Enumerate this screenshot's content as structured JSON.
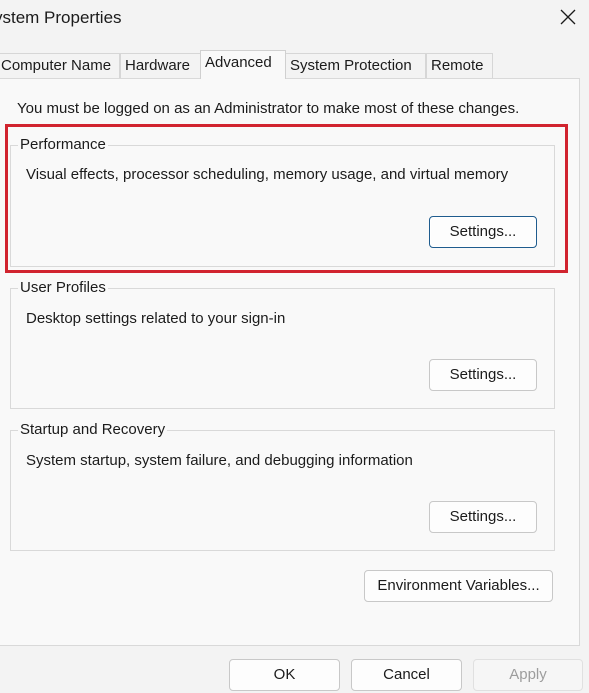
{
  "window": {
    "title": "ystem Properties"
  },
  "tabs": [
    {
      "label": "Computer Name",
      "active": false
    },
    {
      "label": "Hardware",
      "active": false
    },
    {
      "label": "Advanced",
      "active": true
    },
    {
      "label": "System Protection",
      "active": false
    },
    {
      "label": "Remote",
      "active": false
    }
  ],
  "admin_note": "You must be logged on as an Administrator to make most of these changes.",
  "performance": {
    "label": "Performance",
    "description": "Visual effects, processor scheduling, memory usage, and virtual memory",
    "settings_label": "Settings..."
  },
  "user_profiles": {
    "label": "User Profiles",
    "description": "Desktop settings related to your sign-in",
    "settings_label": "Settings..."
  },
  "startup_recovery": {
    "label": "Startup and Recovery",
    "description": "System startup, system failure, and debugging information",
    "settings_label": "Settings..."
  },
  "environment_variables_label": "Environment Variables...",
  "footer": {
    "ok_label": "OK",
    "cancel_label": "Cancel",
    "apply_label": "Apply"
  },
  "icons": {
    "close": "close-icon"
  },
  "colors": {
    "highlight": "#d1242f",
    "focus_border": "#1f5c8e"
  }
}
